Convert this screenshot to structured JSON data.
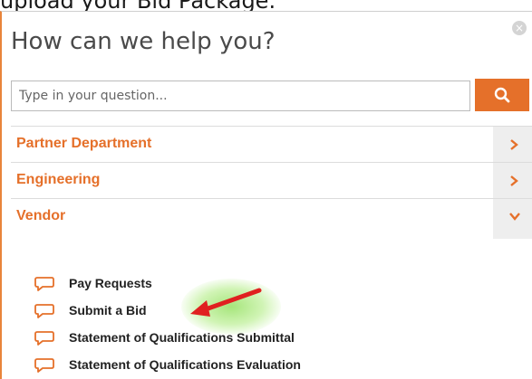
{
  "background_caption": "upload your Bid Package.",
  "dialog": {
    "close_glyph": "×",
    "title": "How can we help you?",
    "search": {
      "placeholder": "Type in your question...",
      "value": ""
    },
    "categories": [
      {
        "label": "Partner Department",
        "state": "collapsed"
      },
      {
        "label": "Engineering",
        "state": "collapsed"
      },
      {
        "label": "Vendor",
        "state": "expanded"
      }
    ],
    "vendor_items": [
      {
        "label": "Pay Requests"
      },
      {
        "label": "Submit a Bid"
      },
      {
        "label": "Statement of Qualifications Submittal"
      },
      {
        "label": "Statement of Qualifications Evaluation"
      }
    ]
  },
  "annotation": {
    "arrow_color": "#e02020",
    "highlight_color": "#9de26a"
  },
  "colors": {
    "accent": "#e5702a",
    "panel_border": "#e8843a",
    "chevron_bg": "#eeeeee"
  },
  "icons": {
    "search": "search-icon",
    "chevron": "chevron-icon",
    "item": "speech-bubble-icon"
  }
}
